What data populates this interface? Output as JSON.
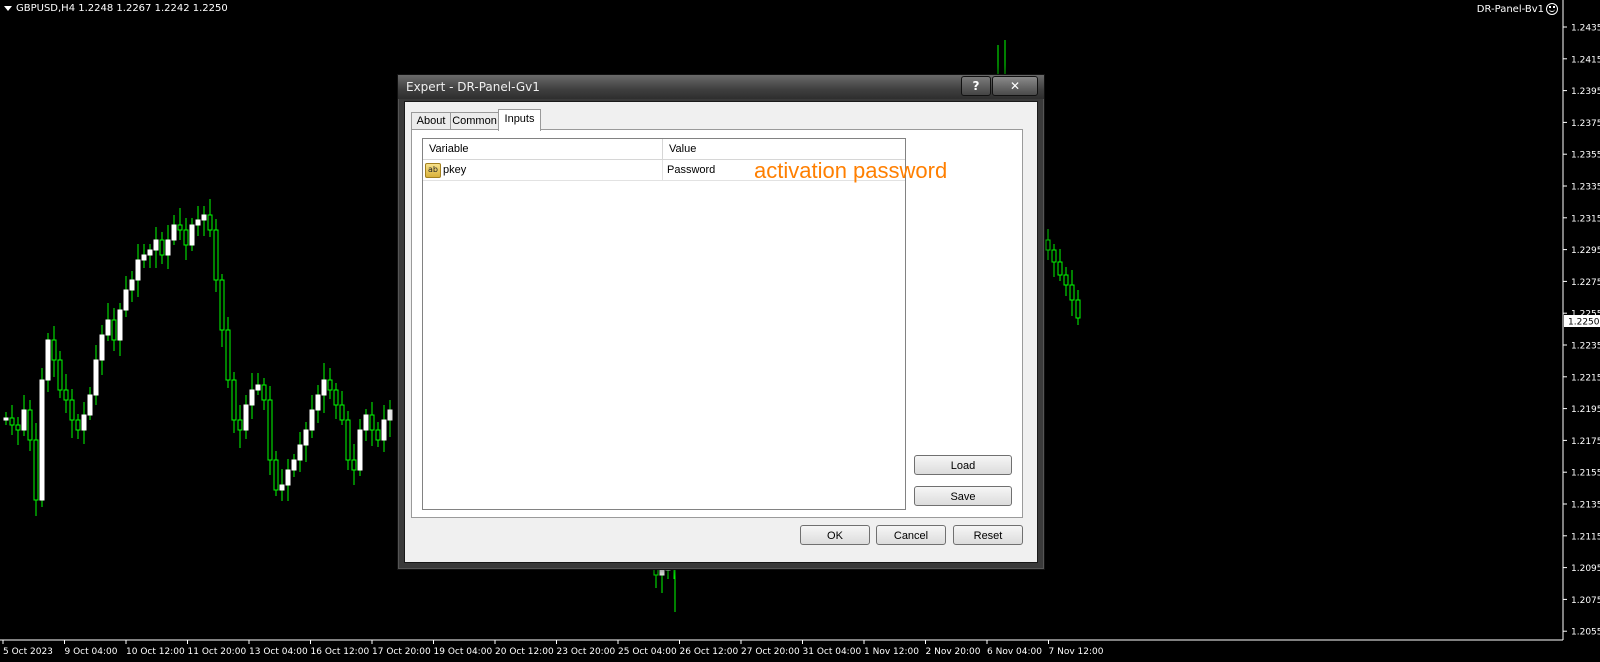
{
  "chart": {
    "symbol_info": "GBPUSD,H4  1.2248 1.2267 1.2242 1.2250",
    "ea_name": "DR-Panel-Bv1",
    "current_price": "1.2250",
    "price_labels": [
      "1.2435",
      "1.2415",
      "1.2395",
      "1.2375",
      "1.2355",
      "1.2335",
      "1.2315",
      "1.2295",
      "1.2275",
      "1.2255",
      "1.2235",
      "1.2215",
      "1.2195",
      "1.2175",
      "1.2155",
      "1.2135",
      "1.2115",
      "1.2095",
      "1.2075",
      "1.2055"
    ],
    "time_labels": [
      "5 Oct 2023",
      "9 Oct 04:00",
      "10 Oct 12:00",
      "11 Oct 20:00",
      "13 Oct 04:00",
      "16 Oct 12:00",
      "17 Oct 20:00",
      "19 Oct 04:00",
      "20 Oct 12:00",
      "23 Oct 20:00",
      "25 Oct 04:00",
      "26 Oct 12:00",
      "27 Oct 20:00",
      "31 Oct 04:00",
      "1 Nov 12:00",
      "2 Nov 20:00",
      "6 Nov 04:00",
      "7 Nov 12:00"
    ],
    "colors": {
      "bull": "#ffffff",
      "bear": "#00ff00",
      "wick": "#00ff00",
      "axis_text": "#ffffff",
      "background": "#000000"
    }
  },
  "dialog": {
    "title": "Expert - DR-Panel-Gv1",
    "help_label": "?",
    "close_label": "✕",
    "tabs": [
      {
        "label": "About",
        "active": false
      },
      {
        "label": "Common",
        "active": false
      },
      {
        "label": "Inputs",
        "active": true
      }
    ],
    "table": {
      "columns": [
        "Variable",
        "Value"
      ],
      "rows": [
        {
          "icon": "ab",
          "variable": "pkey",
          "value": "Password"
        }
      ]
    },
    "annotation": "activation password",
    "buttons": {
      "load": "Load",
      "save": "Save",
      "ok": "OK",
      "cancel": "Cancel",
      "reset": "Reset"
    }
  }
}
